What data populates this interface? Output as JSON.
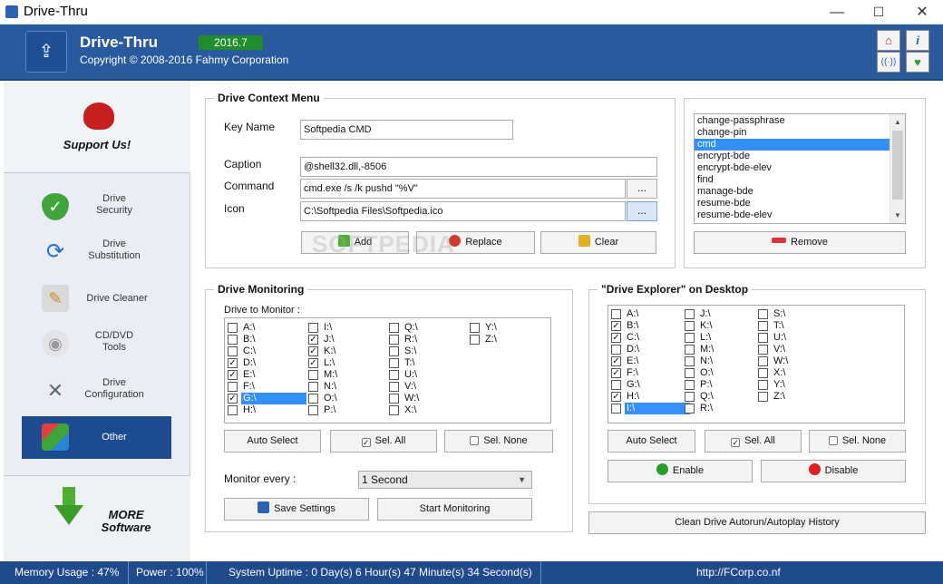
{
  "window": {
    "title": "Drive-Thru",
    "minimize": "—",
    "maximize": "☐",
    "close": "✕"
  },
  "header": {
    "app_name": "Drive-Thru",
    "version": "2016.7",
    "copyright": "Copyright © 2008-2016 Fahmy Corporation"
  },
  "sidebar": {
    "support": "Support Us!",
    "items": [
      {
        "label": "Drive\nSecurity"
      },
      {
        "label": "Drive\nSubstitution"
      },
      {
        "label": "Drive Cleaner"
      },
      {
        "label": "CD/DVD\nTools"
      },
      {
        "label": "Drive\nConfiguration"
      },
      {
        "label": "Other"
      }
    ],
    "more": "MORE\nSoftware"
  },
  "context_menu": {
    "title": "Drive Context Menu",
    "key_name_label": "Key Name",
    "key_name_value": "Softpedia CMD",
    "caption_label": "Caption",
    "caption_value": "@shell32.dll,-8506",
    "command_label": "Command",
    "command_value": "cmd.exe /s /k pushd \"%V\"",
    "icon_label": "Icon",
    "icon_value": "C:\\Softpedia Files\\Softpedia.ico",
    "browse": "...",
    "add": "Add",
    "replace": "Replace",
    "clear": "Clear",
    "remove": "Remove",
    "list": [
      "change-passphrase",
      "change-pin",
      "cmd",
      "encrypt-bde",
      "encrypt-bde-elev",
      "find",
      "manage-bde",
      "resume-bde",
      "resume-bde-elev"
    ],
    "selected": "cmd"
  },
  "monitoring": {
    "title": "Drive Monitoring",
    "drive_label": "Drive to Monitor :",
    "columns": [
      [
        "A:\\",
        "B:\\",
        "C:\\",
        "D:\\",
        "E:\\",
        "F:\\",
        "G:\\",
        "H:\\"
      ],
      [
        "I:\\",
        "J:\\",
        "K:\\",
        "L:\\",
        "M:\\",
        "N:\\",
        "O:\\",
        "P:\\"
      ],
      [
        "Q:\\",
        "R:\\",
        "S:\\",
        "T:\\",
        "U:\\",
        "V:\\",
        "W:\\",
        "X:\\"
      ],
      [
        "Y:\\",
        "Z:\\"
      ]
    ],
    "checked": [
      "D:\\",
      "E:\\",
      "G:\\",
      "J:\\",
      "K:\\",
      "L:\\"
    ],
    "selected": "G:\\",
    "auto_select": "Auto Select",
    "sel_all": "Sel. All",
    "sel_none": "Sel. None",
    "monitor_every_label": "Monitor every :",
    "interval": "1 Second",
    "save": "Save Settings",
    "start": "Start Monitoring"
  },
  "explorer": {
    "title": "\"Drive Explorer\" on Desktop",
    "columns": [
      [
        "A:\\",
        "B:\\",
        "C:\\",
        "D:\\",
        "E:\\",
        "F:\\",
        "G:\\",
        "H:\\",
        "I:\\"
      ],
      [
        "J:\\",
        "K:\\",
        "L:\\",
        "M:\\",
        "N:\\",
        "O:\\",
        "P:\\",
        "Q:\\",
        "R:\\"
      ],
      [
        "S:\\",
        "T:\\",
        "U:\\",
        "V:\\",
        "W:\\",
        "X:\\",
        "Y:\\",
        "Z:\\"
      ]
    ],
    "checked": [
      "B:\\",
      "C:\\",
      "E:\\",
      "F:\\",
      "H:\\"
    ],
    "selected": "I:\\",
    "auto_select": "Auto Select",
    "sel_all": "Sel. All",
    "sel_none": "Sel. None",
    "enable": "Enable",
    "disable": "Disable",
    "clean_history": "Clean Drive Autorun/Autoplay History"
  },
  "status": {
    "memory": "Memory Usage : 47%",
    "power": "Power : 100%",
    "uptime": "System Uptime : 0 Day(s) 6 Hour(s) 47 Minute(s) 34 Second(s)",
    "url": "http://FCorp.co.nf"
  },
  "watermark": "SOFTPEDIA",
  "colors": {
    "header_blue": "#2a5a9e",
    "status_blue": "#1f4a8c",
    "selection": "#3391ff",
    "version_green": "#1f8d2b"
  }
}
